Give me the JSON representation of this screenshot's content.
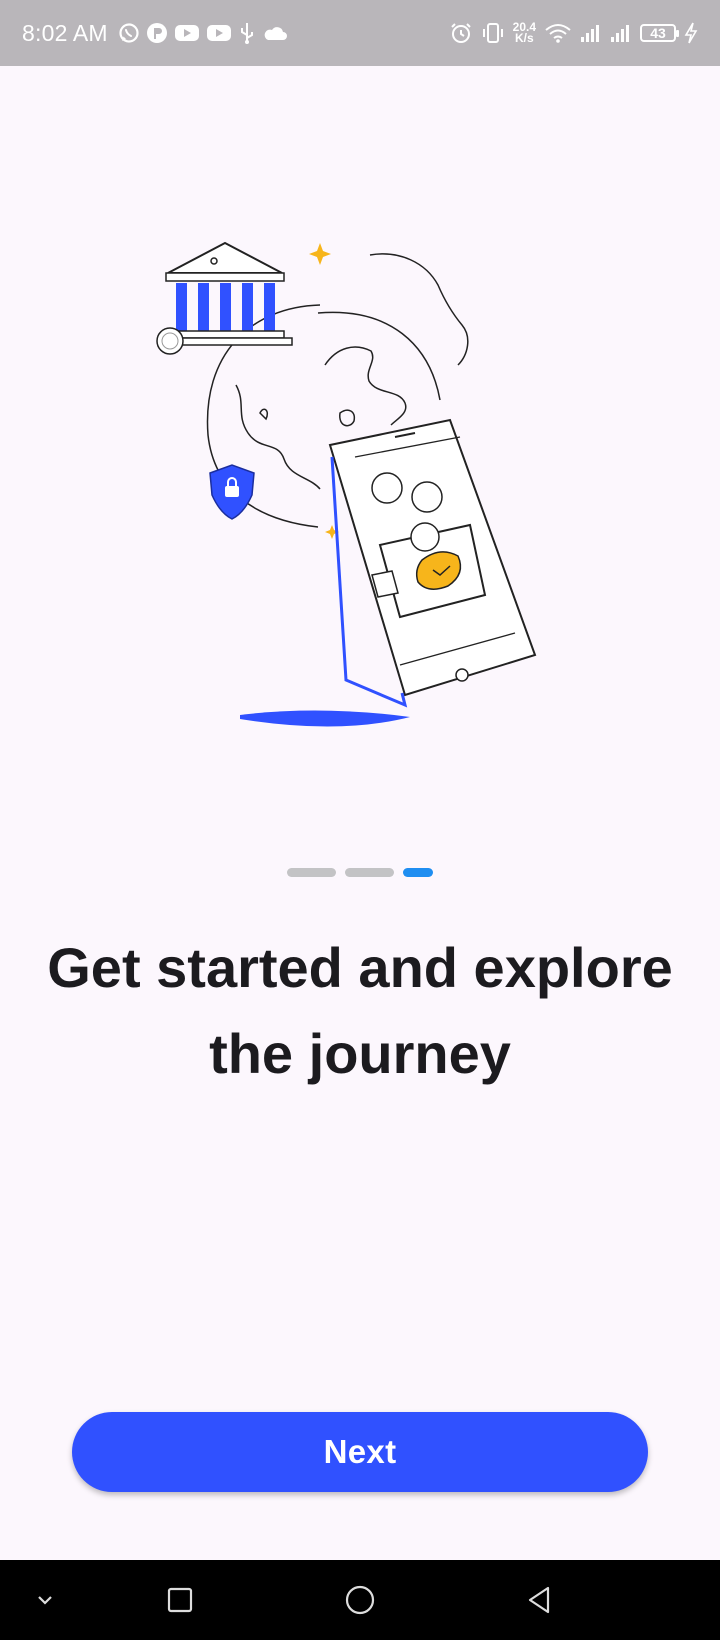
{
  "status_bar": {
    "time": "8:02 AM",
    "net_speed_value": "20.4",
    "net_speed_unit": "K/s",
    "battery": "43",
    "icons_left": [
      "whatsapp-icon",
      "app-icon",
      "youtube-icon",
      "youtube-icon",
      "usb-icon",
      "cloud-icon"
    ],
    "icons_right": [
      "alarm-icon",
      "vibrate-icon",
      "wifi-icon",
      "signal-icon",
      "signal-icon",
      "battery-icon",
      "charging-icon"
    ]
  },
  "onboarding": {
    "illustration": "bank-globe-phone-wallet-illustration",
    "pager": {
      "count": 3,
      "active_index": 2
    },
    "heading": "Get started and explore the journey",
    "next_label": "Next"
  },
  "nav_bar": {
    "icons": [
      "chevron-down-icon",
      "recents-icon",
      "home-icon",
      "back-icon"
    ]
  },
  "colors": {
    "accent": "#3051ff",
    "pager_active": "#1f8ef1",
    "pager_inactive": "#c3c3c5",
    "status_bar": "#b9b6ba",
    "background": "#fcf7fd",
    "coin_yellow": "#f7b51b"
  }
}
